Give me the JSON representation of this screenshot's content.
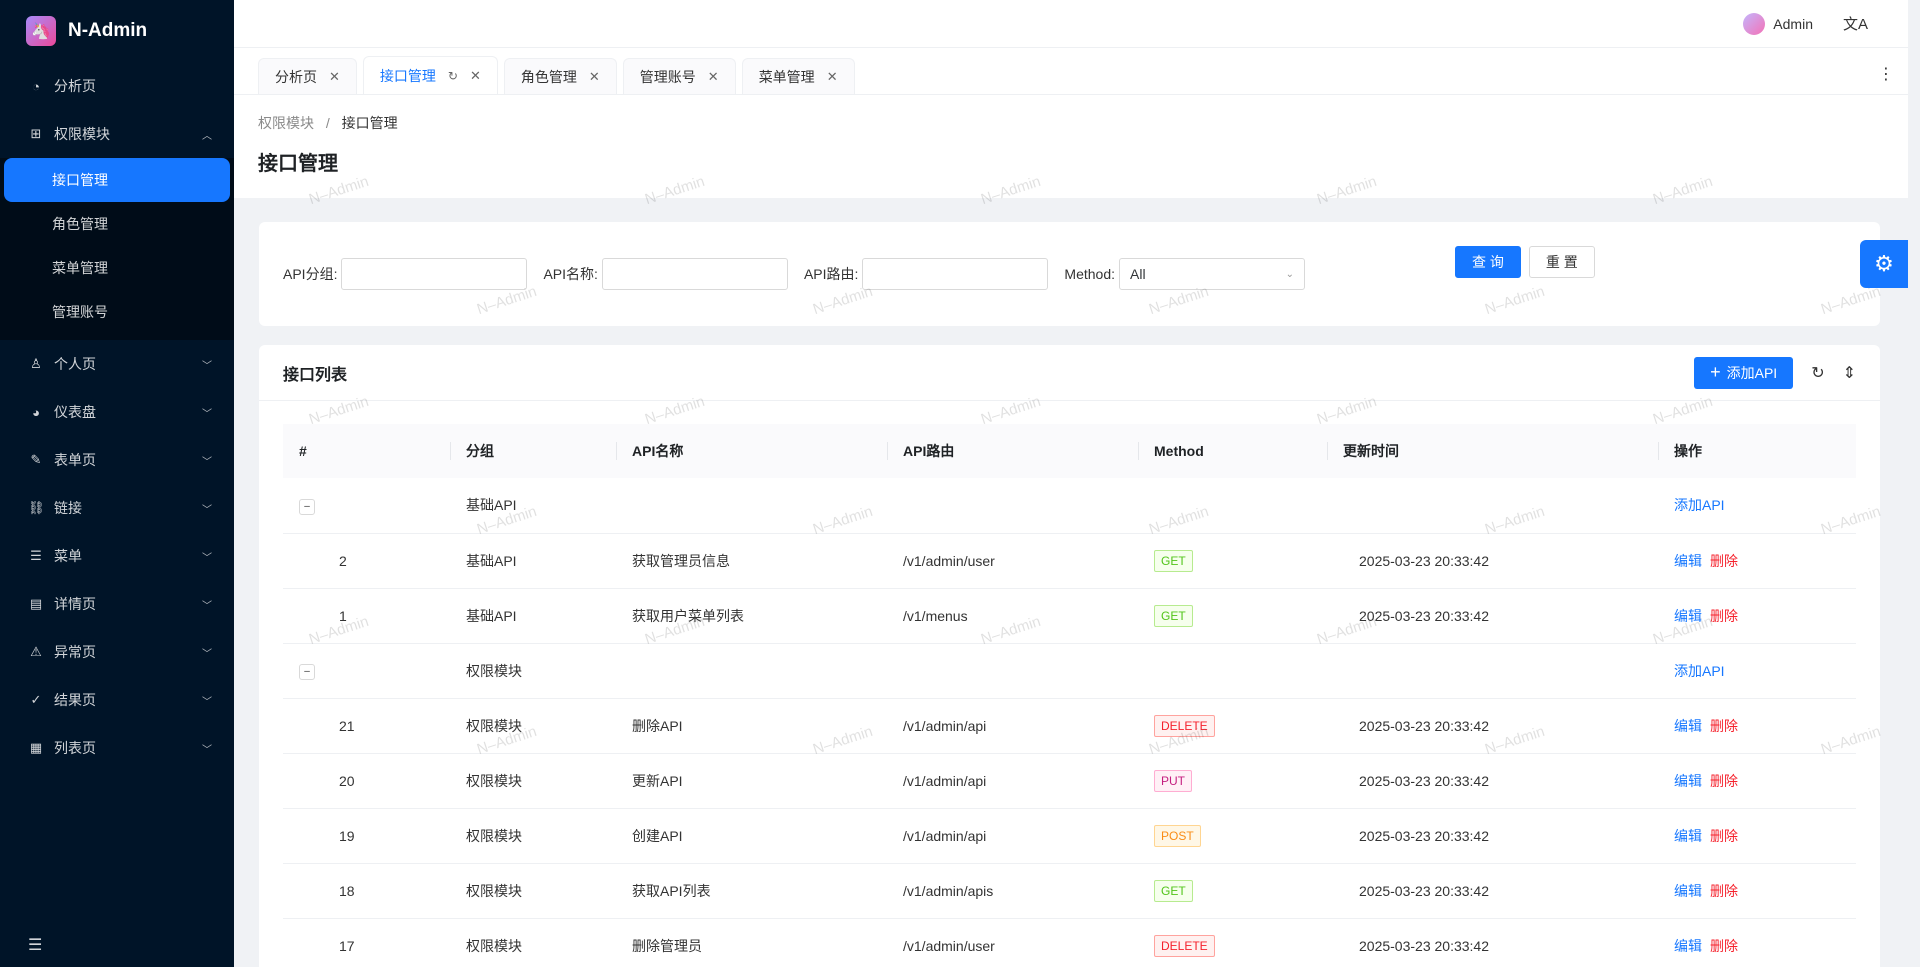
{
  "app": {
    "name": "N-Admin",
    "logo_icon": "unicorn-logo-icon"
  },
  "sidebar": {
    "items": [
      {
        "label": "分析页",
        "icon": "dashboard-icon"
      },
      {
        "label": "权限模块",
        "icon": "org-icon",
        "expanded": true,
        "children": [
          {
            "label": "接口管理",
            "active": true
          },
          {
            "label": "角色管理"
          },
          {
            "label": "菜单管理"
          },
          {
            "label": "管理账号"
          }
        ]
      },
      {
        "label": "个人页",
        "icon": "user-icon"
      },
      {
        "label": "仪表盘",
        "icon": "gauge-icon"
      },
      {
        "label": "表单页",
        "icon": "edit-icon"
      },
      {
        "label": "链接",
        "icon": "link-icon"
      },
      {
        "label": "菜单",
        "icon": "list-icon"
      },
      {
        "label": "详情页",
        "icon": "profile-icon"
      },
      {
        "label": "异常页",
        "icon": "warning-icon"
      },
      {
        "label": "结果页",
        "icon": "check-circle-icon"
      },
      {
        "label": "列表页",
        "icon": "table-icon"
      }
    ]
  },
  "header": {
    "user_name": "Admin"
  },
  "tabs": [
    {
      "label": "分析页"
    },
    {
      "label": "接口管理",
      "active": true
    },
    {
      "label": "角色管理"
    },
    {
      "label": "管理账号"
    },
    {
      "label": "菜单管理"
    }
  ],
  "breadcrumb": {
    "parent": "权限模块",
    "separator": "/",
    "current": "接口管理"
  },
  "page_title": "接口管理",
  "search": {
    "group_label": "API分组:",
    "name_label": "API名称:",
    "path_label": "API路由:",
    "method_label": "Method:",
    "method_value": "All",
    "query_label": "查 询",
    "reset_label": "重 置"
  },
  "table": {
    "title": "接口列表",
    "add_label": "添加API",
    "columns": [
      "#",
      "分组",
      "API名称",
      "API路由",
      "Method",
      "更新时间",
      "操作"
    ],
    "edit_label": "编辑",
    "delete_label": "删除",
    "add_row_label": "添加API",
    "rows": [
      {
        "type": "group",
        "expand": "–",
        "group": "基础API"
      },
      {
        "type": "item",
        "id": "2",
        "group": "基础API",
        "name": "获取管理员信息",
        "path": "/v1/admin/user",
        "method": "GET",
        "time": "2025-03-23 20:33:42"
      },
      {
        "type": "item",
        "id": "1",
        "group": "基础API",
        "name": "获取用户菜单列表",
        "path": "/v1/menus",
        "method": "GET",
        "time": "2025-03-23 20:33:42"
      },
      {
        "type": "group",
        "expand": "–",
        "group": "权限模块"
      },
      {
        "type": "item",
        "id": "21",
        "group": "权限模块",
        "name": "删除API",
        "path": "/v1/admin/api",
        "method": "DELETE",
        "time": "2025-03-23 20:33:42"
      },
      {
        "type": "item",
        "id": "20",
        "group": "权限模块",
        "name": "更新API",
        "path": "/v1/admin/api",
        "method": "PUT",
        "time": "2025-03-23 20:33:42"
      },
      {
        "type": "item",
        "id": "19",
        "group": "权限模块",
        "name": "创建API",
        "path": "/v1/admin/api",
        "method": "POST",
        "time": "2025-03-23 20:33:42"
      },
      {
        "type": "item",
        "id": "18",
        "group": "权限模块",
        "name": "获取API列表",
        "path": "/v1/admin/apis",
        "method": "GET",
        "time": "2025-03-23 20:33:42"
      },
      {
        "type": "item",
        "id": "17",
        "group": "权限模块",
        "name": "删除管理员",
        "path": "/v1/admin/user",
        "method": "DELETE",
        "time": "2025-03-23 20:33:42"
      }
    ]
  },
  "watermark": "N–Admin",
  "colors": {
    "primary": "#1677ff",
    "sidebar_bg": "#001428",
    "danger": "#f5222d"
  }
}
